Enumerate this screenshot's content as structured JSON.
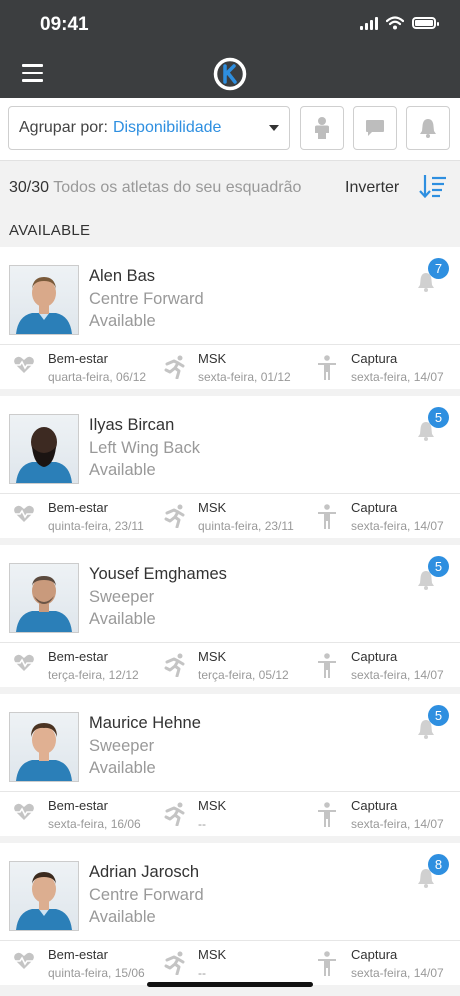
{
  "status_bar": {
    "time": "09:41"
  },
  "filter": {
    "group_label": "Agrupar por:",
    "group_value": "Disponibilidade"
  },
  "summary": {
    "count": "30/30",
    "description": "Todos os atletas do seu esquadrão",
    "invert_label": "Inverter"
  },
  "section_title": "AVAILABLE",
  "colors": {
    "accent": "#2e8fe0",
    "header": "#3c3e40",
    "icon_gray": "#bdbdbd"
  },
  "icons": {
    "wellbeing": "heart-pulse-icon",
    "msk": "runner-icon",
    "capture": "standing-person-icon"
  },
  "athletes": [
    {
      "name": "Alen Bas",
      "position": "Centre Forward",
      "availability": "Available",
      "notifications": "7",
      "wellbeing": {
        "label": "Bem-estar",
        "date": "quarta-feira, 06/12"
      },
      "msk": {
        "label": "MSK",
        "date": "sexta-feira, 01/12"
      },
      "capture": {
        "label": "Captura",
        "date": "sexta-feira, 14/07"
      }
    },
    {
      "name": "Ilyas Bircan",
      "position": "Left Wing Back",
      "availability": "Available",
      "notifications": "5",
      "wellbeing": {
        "label": "Bem-estar",
        "date": "quinta-feira, 23/11"
      },
      "msk": {
        "label": "MSK",
        "date": "quinta-feira, 23/11"
      },
      "capture": {
        "label": "Captura",
        "date": "sexta-feira, 14/07"
      }
    },
    {
      "name": "Yousef Emghames",
      "position": "Sweeper",
      "availability": "Available",
      "notifications": "5",
      "wellbeing": {
        "label": "Bem-estar",
        "date": "terça-feira, 12/12"
      },
      "msk": {
        "label": "MSK",
        "date": "terça-feira, 05/12"
      },
      "capture": {
        "label": "Captura",
        "date": "sexta-feira, 14/07"
      }
    },
    {
      "name": "Maurice Hehne",
      "position": "Sweeper",
      "availability": "Available",
      "notifications": "5",
      "wellbeing": {
        "label": "Bem-estar",
        "date": "sexta-feira, 16/06"
      },
      "msk": {
        "label": "MSK",
        "date": "--"
      },
      "capture": {
        "label": "Captura",
        "date": "sexta-feira, 14/07"
      }
    },
    {
      "name": "Adrian Jarosch",
      "position": "Centre Forward",
      "availability": "Available",
      "notifications": "8",
      "wellbeing": {
        "label": "Bem-estar",
        "date": "quinta-feira, 15/06"
      },
      "msk": {
        "label": "MSK",
        "date": "--"
      },
      "capture": {
        "label": "Captura",
        "date": "sexta-feira, 14/07"
      }
    }
  ]
}
